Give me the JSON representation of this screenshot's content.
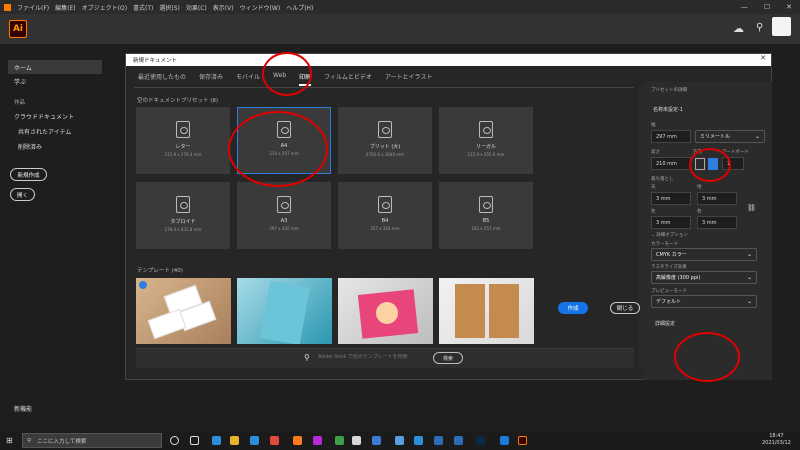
{
  "titlebar": {
    "menu": [
      "ファイル(F)",
      "編集(E)",
      "オブジェクト(O)",
      "書式(T)",
      "選択(S)",
      "効果(C)",
      "表示(V)",
      "ウィンドウ(W)",
      "ヘルプ(H)"
    ],
    "min": "—",
    "max": "☐",
    "close": "✕"
  },
  "app": {
    "logo": "Ai"
  },
  "sidebar": {
    "home": "ホーム",
    "learn": "学ぶ",
    "work_head": "作品",
    "cloud_docs": "クラウドドキュメント",
    "shared": "共有されたアイテム",
    "deleted": "削除済み",
    "new_btn": "新規作成",
    "open_btn": "開く",
    "new_features": "新機能"
  },
  "dialog": {
    "title": "新規ドキュメント",
    "close": "✕",
    "tabs": [
      "最近使用したもの",
      "保存済み",
      "モバイル",
      "Web",
      "印刷",
      "フィルムとビデオ",
      "アートとイラスト"
    ],
    "active_tab": "印刷",
    "preset_header": "空のドキュメントプリセット (8)",
    "presets": [
      {
        "name": "レター",
        "size": "215.9 x 279.4 mm"
      },
      {
        "name": "A4",
        "size": "210 x 297 mm"
      },
      {
        "name": "ブリット (大)",
        "size": "4703.6 x 3048 mm"
      },
      {
        "name": "リーガル",
        "size": "215.9 x 355.6 mm"
      },
      {
        "name": "タブロイド",
        "size": "279.4 x 431.8 mm"
      },
      {
        "name": "A3",
        "size": "297 x 420 mm"
      },
      {
        "name": "B4",
        "size": "257 x 364 mm"
      },
      {
        "name": "B5",
        "size": "182 x 257 mm"
      }
    ],
    "selected_preset": "A4",
    "template_header": "テンプレート (40)",
    "stock_placeholder": "Adobe Stock で他のテンプレートを検索",
    "stock_button": "検索"
  },
  "panel": {
    "header": "プリセットの詳細",
    "doc_name": "名称未設定-1",
    "width_label": "幅",
    "width_value": "297 mm",
    "unit": "ミリメートル",
    "height_label": "高さ",
    "height_value": "210 mm",
    "orientation_label": "方向",
    "artboard_label": "アートボード",
    "artboard_value": "1",
    "bleed_label": "裁ち落とし",
    "bleed_top_label": "天",
    "bleed_bottom_label": "地",
    "bleed_left_label": "左",
    "bleed_right_label": "右",
    "bleed_top": "3 mm",
    "bleed_bottom": "3 mm",
    "bleed_left": "3 mm",
    "bleed_right": "3 mm",
    "adv_options": "詳細オプション",
    "color_mode_label": "カラーモード",
    "color_mode": "CMYK カラー",
    "raster_label": "ラスタライズ効果",
    "raster": "高解像度 (300 ppi)",
    "preview_label": "プレビューモード",
    "preview": "デフォルト",
    "more_settings": "詳細設定",
    "create_btn": "作成",
    "close_btn": "閉じる"
  },
  "taskbar": {
    "search_placeholder": "ここに入力して検索",
    "time": "18:47",
    "date": "2021/03/12"
  }
}
